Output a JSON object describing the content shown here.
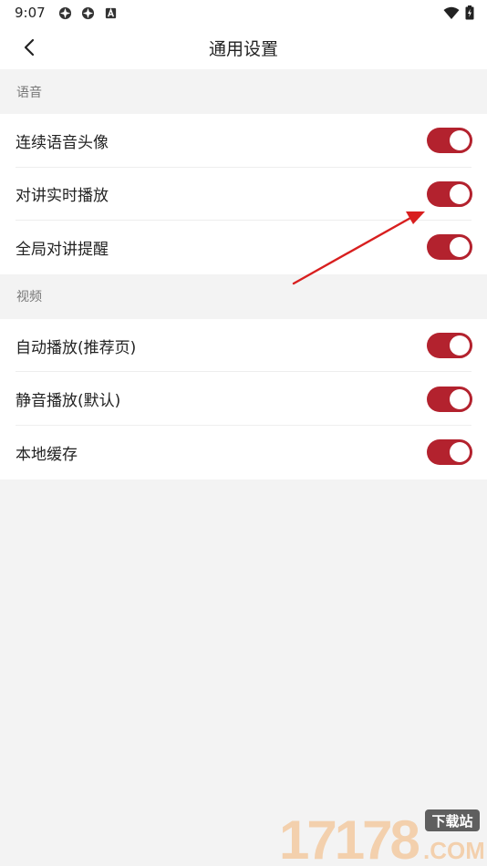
{
  "status_bar": {
    "time": "9:07",
    "icons": [
      "app-notification-icon",
      "app-notification-icon",
      "a-notification-icon",
      "wifi-icon",
      "battery-icon"
    ]
  },
  "app_bar": {
    "title": "通用设置",
    "back_icon": "chevron-left-icon"
  },
  "sections": [
    {
      "header": "语音",
      "items": [
        {
          "label": "连续语音头像",
          "enabled": true
        },
        {
          "label": "对讲实时播放",
          "enabled": true
        },
        {
          "label": "全局对讲提醒",
          "enabled": true
        }
      ]
    },
    {
      "header": "视频",
      "items": [
        {
          "label": "自动播放(推荐页)",
          "enabled": true
        },
        {
          "label": "静音播放(默认)",
          "enabled": true
        },
        {
          "label": "本地缓存",
          "enabled": true
        }
      ]
    }
  ],
  "colors": {
    "accent": "#b3222e",
    "background": "#f3f3f3",
    "annotation_arrow": "#d81f1f"
  },
  "watermark": {
    "number": "17178",
    "tag": "下载站",
    "suffix": ".COM"
  }
}
